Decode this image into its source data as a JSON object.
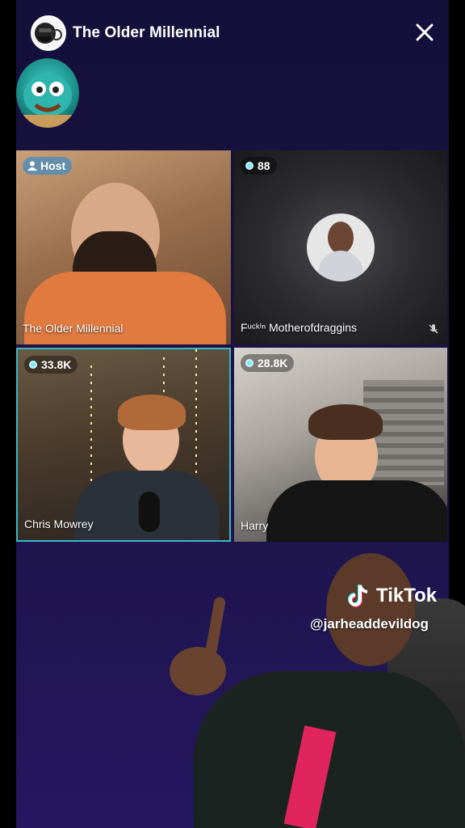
{
  "header": {
    "title": "The Older Millennial"
  },
  "tiles": [
    {
      "badge": "Host",
      "name": "The Older Millennial"
    },
    {
      "badge": "88",
      "name": "Fᵘᶜᵏⁱⁿ Motherofdraggins"
    },
    {
      "badge": "33.8K",
      "name": "Chris Mowrey"
    },
    {
      "badge": "28.8K",
      "name": "Harry"
    }
  ],
  "watermark": {
    "brand": "TikTok",
    "handle": "@jarheaddevildog"
  },
  "colors": {
    "active_border": "#3ab7c9",
    "badge_dot": "#7fe9ff"
  }
}
